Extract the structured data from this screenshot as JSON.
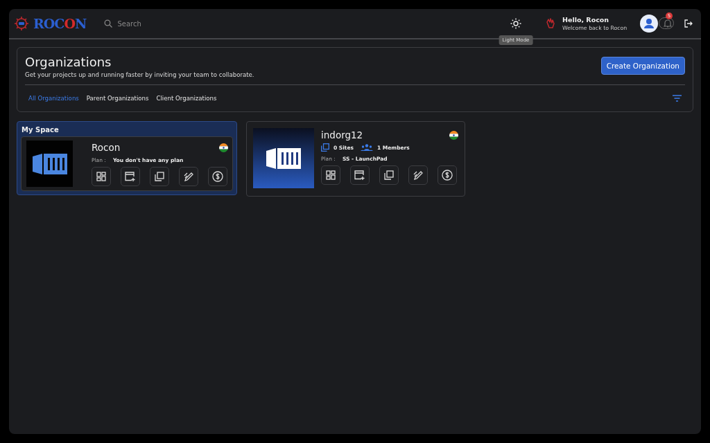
{
  "header": {
    "logo": [
      {
        "text": "ROC",
        "color": "#2b5fd0"
      },
      {
        "text": "O",
        "color": "#d32a2a"
      },
      {
        "text": "N",
        "color": "#2b5fd0"
      }
    ],
    "search": {
      "placeholder": "Search"
    },
    "theme_tooltip": "Light Mode",
    "greeting": "Hello, Rocon",
    "subgreeting": "Welcome back to Rocon",
    "notification_count": "5"
  },
  "organizations_panel": {
    "title": "Organizations",
    "subtitle": "Get your projects up and running faster by inviting your team to collaborate.",
    "create_button": "Create Organization",
    "tabs": [
      {
        "label": "All Organizations",
        "selected": true
      },
      {
        "label": "Parent Organizations",
        "selected": false
      },
      {
        "label": "Client Organizations",
        "selected": false
      }
    ]
  },
  "cards": [
    {
      "kind": "personal",
      "section_title": "My Space",
      "name": "Rocon",
      "plan_label": "Plan :",
      "plan": "You don't have any plan"
    },
    {
      "kind": "organization",
      "name": "indorg12",
      "sites": "0 Sites",
      "members": "1 Members",
      "plan_label": "Plan :",
      "plan": "SS - LaunchPad"
    }
  ]
}
